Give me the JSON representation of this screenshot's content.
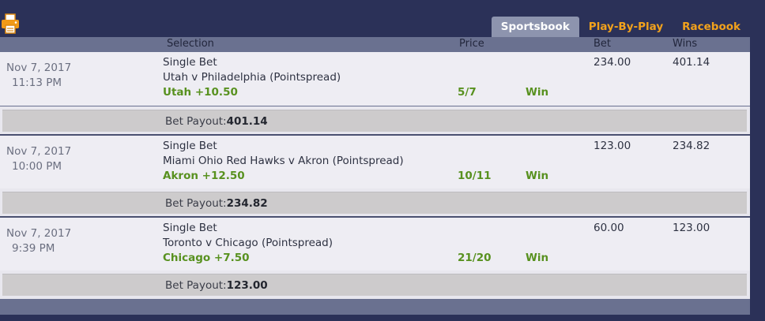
{
  "tabs": [
    {
      "label": "Sportsbook",
      "active": true
    },
    {
      "label": "Play-By-Play",
      "active": false
    },
    {
      "label": "Racebook",
      "active": false
    }
  ],
  "header": {
    "selection": "Selection",
    "price": "Price",
    "bet": "Bet",
    "wins": "Wins"
  },
  "bets": [
    {
      "date": "Nov 7, 2017",
      "time": "11:13 PM",
      "bet_type": "Single Bet",
      "event": "Utah v Philadelphia (Pointspread)",
      "pick": "Utah +10.50",
      "price": "5/7",
      "result": "Win",
      "bet_amount": "234.00",
      "wins_amount": "401.14",
      "payout_label": "Bet Payout:",
      "payout_value": "401.14"
    },
    {
      "date": "Nov 7, 2017",
      "time": "10:00 PM",
      "bet_type": "Single Bet",
      "event": "Miami Ohio Red Hawks v Akron (Pointspread)",
      "pick": "Akron +12.50",
      "price": "10/11",
      "result": "Win",
      "bet_amount": "123.00",
      "wins_amount": "234.82",
      "payout_label": "Bet Payout:",
      "payout_value": "234.82"
    },
    {
      "date": "Nov 7, 2017",
      "time": "9:39 PM",
      "bet_type": "Single Bet",
      "event": "Toronto v Chicago (Pointspread)",
      "pick": "Chicago +7.50",
      "price": "21/20",
      "result": "Win",
      "bet_amount": "60.00",
      "wins_amount": "123.00",
      "payout_label": "Bet Payout:",
      "payout_value": "123.00"
    }
  ],
  "colors": {
    "background": "#2b3158",
    "tab_text": "#f2a21c",
    "win_green": "#58911f",
    "panel": "#6a7190"
  },
  "icons": {
    "print": "printer-icon"
  }
}
